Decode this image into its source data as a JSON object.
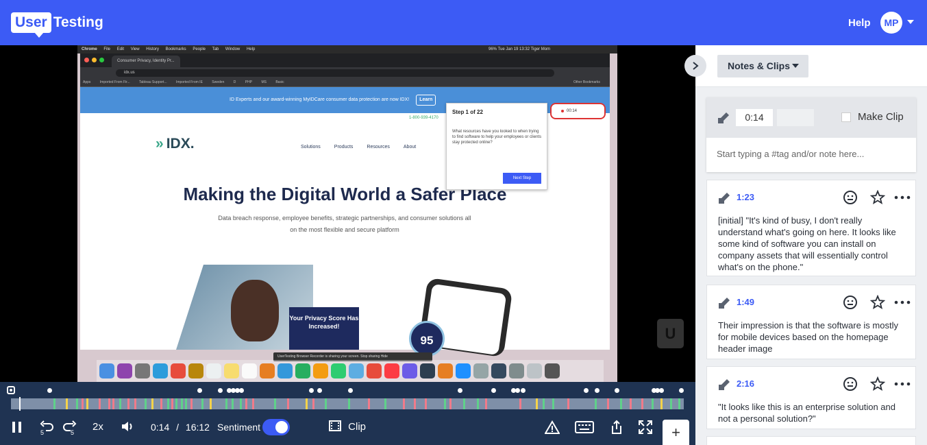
{
  "header": {
    "logo_user": "User",
    "logo_testing": "Testing",
    "help_label": "Help",
    "avatar_initials": "MP"
  },
  "video": {
    "menubar": [
      "Chrome",
      "File",
      "Edit",
      "View",
      "History",
      "Bookmarks",
      "People",
      "Tab",
      "Window",
      "Help"
    ],
    "menubar_right": "96%   Tue Jan 19  13:32   Tiger Mom",
    "tab_title": "Consumer Privacy, Identity Pr...",
    "url": "idx.us",
    "bookmarks": [
      "Apps",
      "Imported From Fir...",
      "Tableau Support...",
      "Imported From IE",
      "Sweden",
      "D",
      "PHP",
      "MS",
      "Basic",
      "Other Bookmarks"
    ],
    "banner_text": "ID Experts and our award-winning MyIDCare consumer data protection are now IDX!",
    "banner_learn": "Learn",
    "phone_number": "1-800-939-4170",
    "site_logo": "IDX.",
    "site_nav": [
      "Solutions",
      "Products",
      "Resources",
      "About"
    ],
    "site_title": "Making the Digital World a Safer Place",
    "site_subtitle": "Data breach response, employee benefits, strategic partnerships, and consumer solutions all on the most flexible and secure platform",
    "privacy_card": "Your Privacy Score Has Increased!",
    "score": "95",
    "share_bar": "UserTesting Browser Recorder is sharing your screen.   Stop sharing   Hide",
    "step_title": "Step 1 of 22",
    "step_question": "What resources have you looked to when trying to find software to help your employees or clients stay protected online?",
    "step_next": "Next Step",
    "rec_time": "00:14",
    "watermark": "U"
  },
  "controls": {
    "rewind_label": "5",
    "forward_label": "5",
    "speed": "2x",
    "current_time": "0:14",
    "separator": "/",
    "duration": "16:12",
    "sentiment_label": "Sentiment",
    "sentiment_on": true,
    "clip_label": "Clip",
    "add_label": "+"
  },
  "panel": {
    "dropdown_label": "Notes & Clips",
    "composer": {
      "time_value": "0:14",
      "make_clip_label": "Make Clip",
      "placeholder": "Start typing a #tag and/or note here..."
    },
    "notes": [
      {
        "time": "1:23",
        "text": "[initial] \"It's kind of busy, I don't really understand what's going on here. It looks like some kind of software you can install on company assets that will essentially control what's on the phone.\""
      },
      {
        "time": "1:49",
        "text": "Their impression is that the software is mostly for mobile devices based on the homepage header image"
      },
      {
        "time": "2:16",
        "text": "\"It looks like this is an enterprise solution and not a personal solution?\""
      }
    ]
  },
  "colors": {
    "brand": "#3c5bf5",
    "controls_bg": "#1f3352",
    "segment_green": "#5fd18a",
    "segment_red": "#f07b8a",
    "segment_yellow": "#f6d34a"
  }
}
